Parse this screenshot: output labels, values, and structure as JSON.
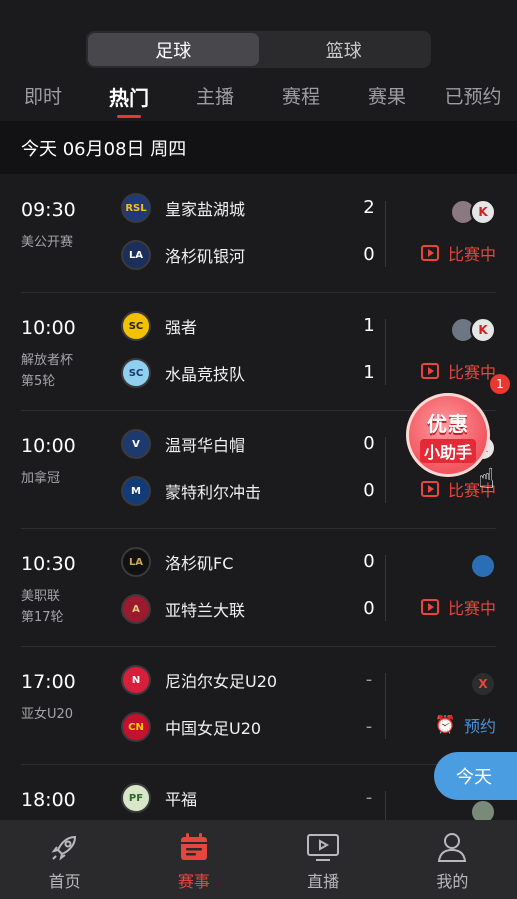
{
  "segmented": {
    "left": "足球",
    "right": "篮球",
    "active": "left"
  },
  "tabs": [
    "即时",
    "热门",
    "主播",
    "赛程",
    "赛果",
    "已预约"
  ],
  "active_tab_index": 1,
  "date_header": "今天 06月08日 周四",
  "matches": [
    {
      "time": "09:30",
      "league": "美公开赛",
      "round": "",
      "home": {
        "name": "皇家盐湖城",
        "logo": "RSL"
      },
      "away": {
        "name": "洛杉矶银河",
        "logo": "LA"
      },
      "home_score": "2",
      "away_score": "0",
      "avatars": [
        "avatar",
        "avatar"
      ],
      "status": "比赛中",
      "status_type": "live"
    },
    {
      "time": "10:00",
      "league": "解放者杯",
      "round": "第5轮",
      "home": {
        "name": "强者",
        "logo": "SC"
      },
      "away": {
        "name": "水晶竞技队",
        "logo": "SC"
      },
      "home_score": "1",
      "away_score": "1",
      "avatars": [
        "avatar",
        "avatar"
      ],
      "status": "比赛中",
      "status_type": "live"
    },
    {
      "time": "10:00",
      "league": "加拿冠",
      "round": "",
      "home": {
        "name": "温哥华白帽",
        "logo": "V"
      },
      "away": {
        "name": "蒙特利尔冲击",
        "logo": "M"
      },
      "home_score": "0",
      "away_score": "0",
      "avatars": [
        "avatar"
      ],
      "status": "比赛中",
      "status_type": "live"
    },
    {
      "time": "10:30",
      "league": "美职联",
      "round": "第17轮",
      "home": {
        "name": "洛杉矶FC",
        "logo": "LA"
      },
      "away": {
        "name": "亚特兰大联",
        "logo": "A"
      },
      "home_score": "0",
      "away_score": "0",
      "avatars": [
        "avatar"
      ],
      "status": "比赛中",
      "status_type": "live"
    },
    {
      "time": "17:00",
      "league": "亚女U20",
      "round": "",
      "home": {
        "name": "尼泊尔女足U20",
        "logo": "N"
      },
      "away": {
        "name": "中国女足U20",
        "logo": "CN"
      },
      "home_score": "-",
      "away_score": "-",
      "avatars": [
        "avatar"
      ],
      "status": "预约",
      "status_type": "book"
    },
    {
      "time": "18:00",
      "league": "",
      "round": "",
      "home": {
        "name": "平福",
        "logo": "PF"
      },
      "away": {
        "name": "",
        "logo": ""
      },
      "home_score": "-",
      "away_score": "",
      "avatars": [
        "avatar"
      ],
      "status": "",
      "status_type": "none"
    }
  ],
  "promo": {
    "line1": "优惠",
    "line2": "小助手",
    "badge": "1"
  },
  "today_button": "今天",
  "bottom_nav": [
    {
      "label": "首页",
      "icon": "rocket-icon"
    },
    {
      "label": "赛事",
      "icon": "calendar-icon"
    },
    {
      "label": "直播",
      "icon": "tv-icon"
    },
    {
      "label": "我的",
      "icon": "person-icon"
    }
  ],
  "active_nav_index": 1,
  "colors": {
    "accent": "#e8453c",
    "book": "#4a90d9",
    "bg": "#1b1b1d"
  }
}
